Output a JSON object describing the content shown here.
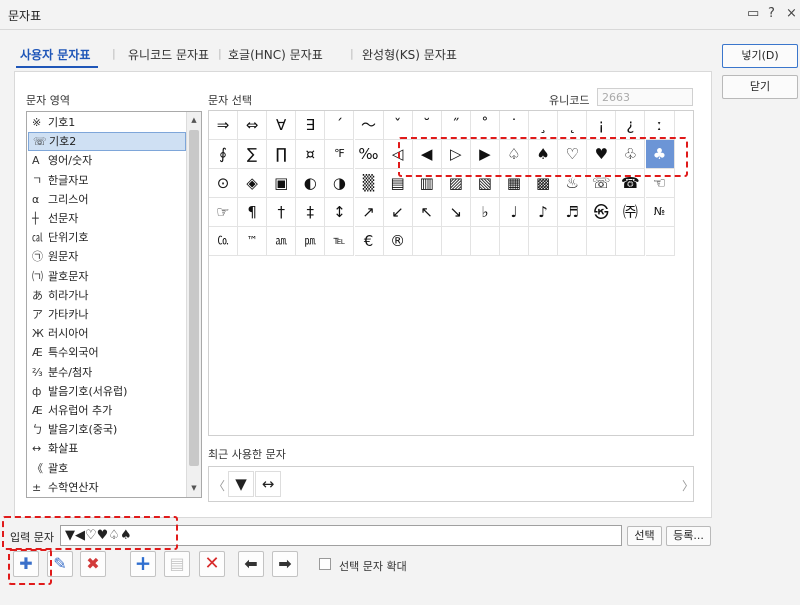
{
  "window": {
    "title": "문자표",
    "help_label": "?",
    "close_label": "×",
    "restore_label": "▭"
  },
  "tabs": [
    {
      "label": "사용자 문자표"
    },
    {
      "label": "유니코드 문자표"
    },
    {
      "label": "호글(HNC) 문자표"
    },
    {
      "label": "완성형(KS) 문자표"
    }
  ],
  "labels": {
    "area": "문자 영역",
    "select": "문자 선택",
    "unicode": "유니코드",
    "recent": "최근 사용한 문자",
    "input": "입력 문자",
    "enlarge": "선택 문자 확대"
  },
  "unicode_value": "2663",
  "area_list": [
    {
      "icon": "※",
      "label": "기호1"
    },
    {
      "icon": "☏",
      "label": "기호2",
      "selected": true
    },
    {
      "icon": "A",
      "label": "영어/숫자"
    },
    {
      "icon": "ㄱ",
      "label": "한글자모"
    },
    {
      "icon": "α",
      "label": "그리스어"
    },
    {
      "icon": "┼",
      "label": "선문자"
    },
    {
      "icon": "㎈",
      "label": "단위기호"
    },
    {
      "icon": "㉠",
      "label": "원문자"
    },
    {
      "icon": "㈀",
      "label": "괄호문자"
    },
    {
      "icon": "あ",
      "label": "히라가나"
    },
    {
      "icon": "ア",
      "label": "가타카나"
    },
    {
      "icon": "Ж",
      "label": "러시아어"
    },
    {
      "icon": "Æ",
      "label": "특수외국어"
    },
    {
      "icon": "⅔",
      "label": "분수/첨자"
    },
    {
      "icon": "ф",
      "label": "발음기호(서유럽)"
    },
    {
      "icon": "Æ",
      "label": "서유럽어 추가"
    },
    {
      "icon": "ㄅ",
      "label": "발음기호(중국)"
    },
    {
      "icon": "↔",
      "label": "화살표"
    },
    {
      "icon": "《",
      "label": "괄호"
    },
    {
      "icon": "±",
      "label": "수학연산자"
    }
  ],
  "grid": [
    [
      "⇒",
      "⇔",
      "∀",
      "∃",
      "´",
      "～",
      "ˇ",
      "˘",
      "˝",
      "˚",
      "˙",
      "¸",
      "˛",
      "¡",
      "¿",
      "ː"
    ],
    [
      "∮",
      "∑",
      "∏",
      "¤",
      "℉",
      "‰",
      "◁",
      "◀",
      "▷",
      "▶",
      "♤",
      "♠",
      "♡",
      "♥",
      "♧",
      "♣"
    ],
    [
      "⊙",
      "◈",
      "▣",
      "◐",
      "◑",
      "▒",
      "▤",
      "▥",
      "▨",
      "▧",
      "▦",
      "▩",
      "♨",
      "☏",
      "☎",
      "☜"
    ],
    [
      "☞",
      "¶",
      "†",
      "‡",
      "↕",
      "↗",
      "↙",
      "↖",
      "↘",
      "♭",
      "♩",
      "♪",
      "♬",
      "㉿",
      "㈜",
      "№"
    ],
    [
      "㏇",
      "™",
      "㏂",
      "㏘",
      "℡",
      "€",
      "®",
      "",
      "",
      "",
      "",
      "",
      "",
      "",
      "",
      ""
    ]
  ],
  "selected_char": "♣",
  "recent_chars": [
    "▼",
    "↔"
  ],
  "input_value": "▼◀♡♥♤♠",
  "buttons": {
    "insert": "넣기(D)",
    "close": "닫기",
    "select": "선택",
    "register": "등록..."
  },
  "toolbar_icons": [
    "add-char-icon",
    "edit-char-icon",
    "delete-char-icon",
    "plus-icon",
    "add-page-icon",
    "x-icon",
    "arrow-left-icon",
    "arrow-right-icon"
  ],
  "colors": {
    "accent": "#1f56b8",
    "selection": "#6c95d6",
    "highlight": "#e01a1a"
  }
}
